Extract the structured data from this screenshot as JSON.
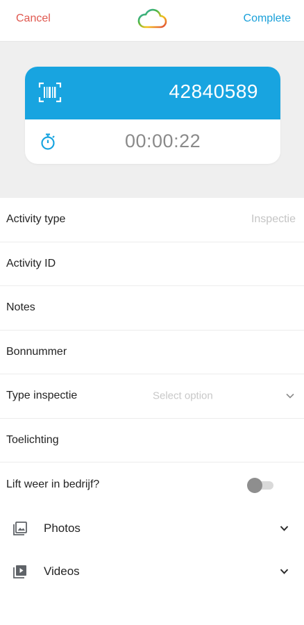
{
  "header": {
    "cancel_label": "Cancel",
    "complete_label": "Complete",
    "logo_icon": "cloud-logo-icon"
  },
  "card": {
    "number": "42840589",
    "timer": "00:00:22",
    "accent_color": "#18a4e0"
  },
  "form": {
    "activity_type": {
      "label": "Activity type",
      "value": "Inspectie"
    },
    "activity_id": {
      "label": "Activity ID"
    },
    "notes": {
      "label": "Notes"
    },
    "bonnummer": {
      "label": "Bonnummer"
    },
    "type_inspectie": {
      "label": "Type inspectie",
      "placeholder": "Select option"
    },
    "toelichting": {
      "label": "Toelichting"
    },
    "lift_weer": {
      "label": "Lift weer in bedrijf?",
      "toggle_on": false
    }
  },
  "media": {
    "photos_label": "Photos",
    "videos_label": "Videos"
  },
  "colors": {
    "cancel": "#e0584f",
    "complete": "#1aa0d9"
  }
}
